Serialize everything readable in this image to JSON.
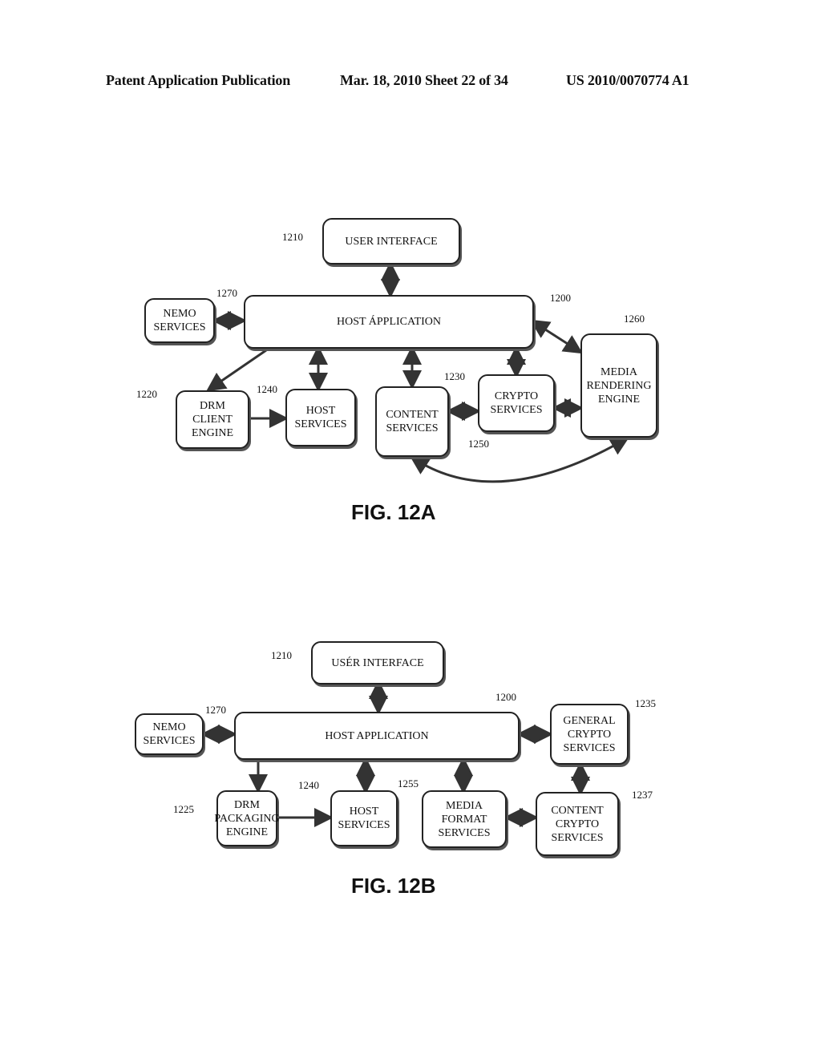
{
  "header": {
    "left": "Patent Application Publication",
    "center": "Mar. 18, 2010  Sheet 22 of 34",
    "right": "US 2010/0070774 A1"
  },
  "fig12a": {
    "caption": "FIG. 12A",
    "boxes": {
      "user_interface": "USER INTERFACE",
      "host_application": "HOST ÁPPLICATION",
      "nemo_services": "NEMO\nSERVICES",
      "drm_client_engine": "DRM\nCLIENT\nENGINE",
      "host_services": "HOST\nSERVICES",
      "content_services": "CONTENT\nSERVICES",
      "crypto_services": "CRYPTO\nSERVICES",
      "media_rendering_engine": "MEDIA\nRENDERING\nENGINE"
    },
    "refs": {
      "user_interface": "1210",
      "nemo_services": "1270",
      "host_application": "1200",
      "media_rendering_engine": "1260",
      "drm_client_engine": "1220",
      "host_services": "1240",
      "crypto_services": "1230",
      "content_services": "1250"
    }
  },
  "fig12b": {
    "caption": "FIG. 12B",
    "boxes": {
      "user_interface": "USÉR INTERFACE",
      "host_application": "HOST APPLICATION",
      "nemo_services": "NEMO\nSERVICES",
      "general_crypto_services": "GENERAL\nCRYPTO\nSERVICES",
      "drm_packaging_engine": "DRM\nPACKAGING\nENGINE",
      "host_services": "HOST\nSERVICES",
      "media_format_services": "MEDIA\nFORMAT\nSERVICES",
      "content_crypto_services": "CONTENT\nCRYPTO\nSERVICES"
    },
    "refs": {
      "user_interface": "1210",
      "host_application": "1200",
      "nemo_services": "1270",
      "general_crypto_services": "1235",
      "drm_packaging_engine": "1225",
      "host_services": "1240",
      "media_format_services": "1255",
      "content_crypto_services": "1237"
    }
  }
}
